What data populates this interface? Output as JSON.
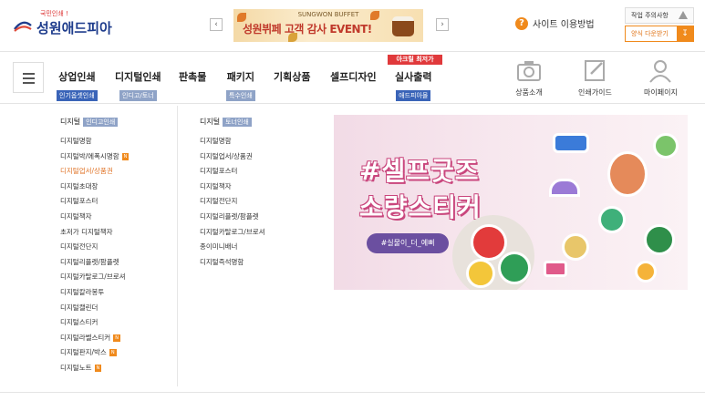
{
  "header": {
    "logo_tag": "국민인쇄 !",
    "logo_name": "성원애드피아",
    "banner": {
      "subtitle": "SUNGWON BUFFET",
      "headline": "성원뷔페 고객 감사 EVENT!"
    },
    "help_label": "사이트 이용방법",
    "notice_label": "작업 주의사항",
    "download_label": "양식 다운받기"
  },
  "nav": {
    "items": [
      {
        "label": "상업인쇄",
        "sub": "인기옵셋인쇄"
      },
      {
        "label": "디지털인쇄",
        "sub": "인디고/토너"
      },
      {
        "label": "판촉물",
        "sub": ""
      },
      {
        "label": "패키지",
        "sub": "특수인쇄"
      },
      {
        "label": "기획상품",
        "sub": ""
      },
      {
        "label": "셀프디자인",
        "sub": ""
      },
      {
        "label": "실사출력",
        "sub": "애드피아몰"
      }
    ],
    "badge": "아크릴 최저가",
    "utils": [
      {
        "label": "상품소개",
        "icon": "camera-icon"
      },
      {
        "label": "인쇄가이드",
        "icon": "edit-icon"
      },
      {
        "label": "마이페이지",
        "icon": "user-icon"
      }
    ]
  },
  "dropdown": {
    "col1": {
      "head": "디지털",
      "tag": "인디고인쇄",
      "items": [
        {
          "label": "디지털명함",
          "new": false,
          "active": false
        },
        {
          "label": "디지털박/에폭시명함",
          "new": true,
          "active": false
        },
        {
          "label": "디지털업서/상품권",
          "new": false,
          "active": true
        },
        {
          "label": "디지털초대장",
          "new": false,
          "active": false
        },
        {
          "label": "디지털포스터",
          "new": false,
          "active": false
        },
        {
          "label": "디지털책자",
          "new": false,
          "active": false
        },
        {
          "label": "초저가 디지털책자",
          "new": false,
          "active": false
        },
        {
          "label": "디지털전단지",
          "new": false,
          "active": false
        },
        {
          "label": "디지털리플렛/팜플렛",
          "new": false,
          "active": false
        },
        {
          "label": "디지털카탈로그/브로셔",
          "new": false,
          "active": false
        },
        {
          "label": "디지털칼라봉투",
          "new": false,
          "active": false
        },
        {
          "label": "디지털캘린더",
          "new": false,
          "active": false
        },
        {
          "label": "디지털스티커",
          "new": false,
          "active": false
        },
        {
          "label": "디지털라벨스티커",
          "new": true,
          "active": false
        },
        {
          "label": "디지털판지/박스",
          "new": true,
          "active": false
        },
        {
          "label": "디지털노트",
          "new": true,
          "active": false
        }
      ]
    },
    "col2": {
      "head": "디지털",
      "tag": "토너인쇄",
      "items": [
        {
          "label": "디지털명함"
        },
        {
          "label": "디지털업서/상품권"
        },
        {
          "label": "디지털포스터"
        },
        {
          "label": "디지털책자"
        },
        {
          "label": "디지털전단지"
        },
        {
          "label": "디지털리플렛/팜플렛"
        },
        {
          "label": "디지털카탈로그/브로셔"
        },
        {
          "label": "종이미니배너"
        },
        {
          "label": "디지털즉석명함"
        }
      ]
    },
    "promo": {
      "line1": "#셀프굿즈",
      "line2": "소량스티커",
      "hashtag": "#실물이_더_예뻐"
    },
    "new_tag": "N"
  }
}
